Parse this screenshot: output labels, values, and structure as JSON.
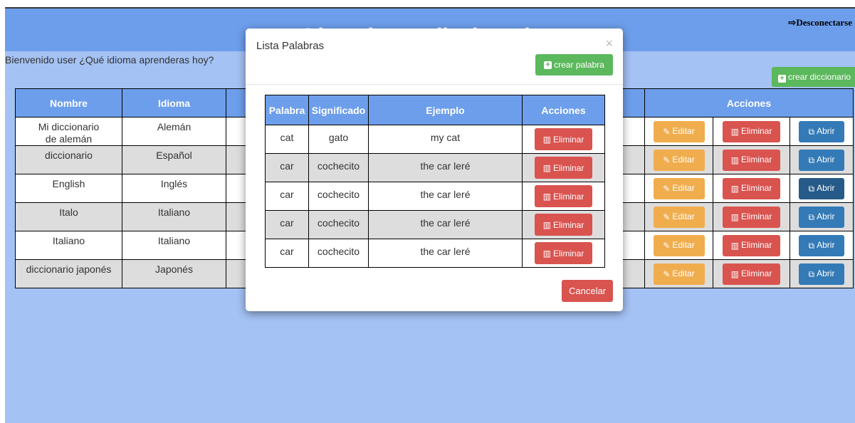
{
  "header": {
    "title": "Lista de tus diccionarios",
    "logout_icon": "sign-out-icon",
    "logout_label": "Desconectarse"
  },
  "welcome_text": "Bienvenido user ¿Qué idioma aprenderas hoy?",
  "new_dictionary_button": "crear diccionario",
  "dictionaries_table": {
    "headers": [
      "Nombre",
      "Idioma",
      "",
      "Acciones"
    ],
    "rows": [
      {
        "name": "Mi diccionario de alemán",
        "language": "Alemán"
      },
      {
        "name": "diccionario",
        "language": "Español"
      },
      {
        "name": "English",
        "language": "Inglés"
      },
      {
        "name": "Italo",
        "language": "Italiano"
      },
      {
        "name": "Italiano",
        "language": "Italiano"
      },
      {
        "name": "diccionario japonés",
        "language": "Japonés"
      }
    ],
    "edit_label": "Editar",
    "delete_label": "Eliminar",
    "open_label": "Abrir"
  },
  "modal": {
    "title": "Lista Palabras",
    "close_symbol": "×",
    "new_word_button": "crear palabra",
    "table_headers": [
      "Palabra",
      "Significado",
      "Ejemplo",
      "Acciones"
    ],
    "words": [
      {
        "word": "cat",
        "meaning": "gato",
        "example": "my cat"
      },
      {
        "word": "car",
        "meaning": "cochecito",
        "example": "the car leré"
      },
      {
        "word": "car",
        "meaning": "cochecito",
        "example": "the car leré"
      },
      {
        "word": "car",
        "meaning": "cochecito",
        "example": "the car leré"
      },
      {
        "word": "car",
        "meaning": "cochecito",
        "example": "the car leré"
      }
    ],
    "delete_label": "Eliminar",
    "cancel_button": "Cancelar"
  },
  "colors": {
    "header_bar": "#6d9eeb",
    "background": "#a4c2f4",
    "success": "#5cb85c",
    "warning": "#f0ad4e",
    "danger": "#d9534f",
    "primary": "#337ab7"
  }
}
